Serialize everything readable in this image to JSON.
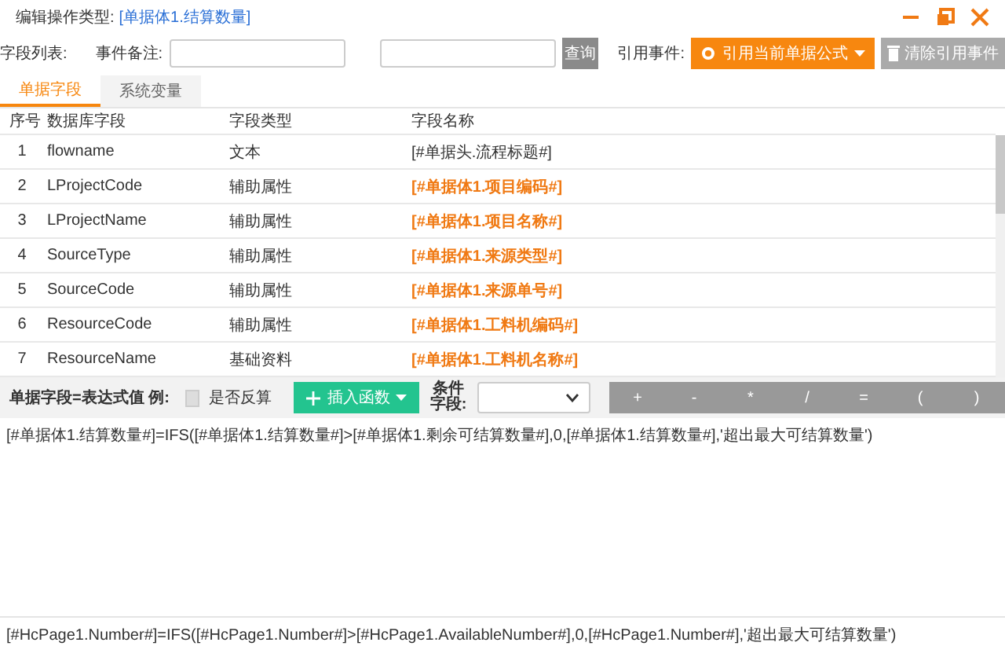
{
  "window": {
    "title_label": "编辑操作类型:",
    "title_value": "[单据体1.结算数量]"
  },
  "toolbar": {
    "field_list_label": "字段列表:",
    "remark_label": "事件备注:",
    "query_button": "查询",
    "reference_label": "引用事件:",
    "reference_button": "引用当前单据公式",
    "clear_button": "清除引用事件"
  },
  "tabs": [
    {
      "label": "单据字段",
      "selected": true
    },
    {
      "label": "系统变量",
      "selected": false
    }
  ],
  "table": {
    "columns": [
      "序号",
      "数据库字段",
      "字段类型",
      "字段名称"
    ],
    "rows": [
      {
        "no": "1",
        "field": "flowname",
        "type": "文本",
        "name": "[#单据头.流程标题#]",
        "highlighted": false
      },
      {
        "no": "2",
        "field": "LProjectCode",
        "type": "辅助属性",
        "name": "[#单据体1.项目编码#]",
        "highlighted": true
      },
      {
        "no": "3",
        "field": "LProjectName",
        "type": "辅助属性",
        "name": "[#单据体1.项目名称#]",
        "highlighted": true
      },
      {
        "no": "4",
        "field": "SourceType",
        "type": "辅助属性",
        "name": "[#单据体1.来源类型#]",
        "highlighted": true
      },
      {
        "no": "5",
        "field": "SourceCode",
        "type": "辅助属性",
        "name": "[#单据体1.来源单号#]",
        "highlighted": true
      },
      {
        "no": "6",
        "field": "ResourceCode",
        "type": "辅助属性",
        "name": "[#单据体1.工料机编码#]",
        "highlighted": true
      },
      {
        "no": "7",
        "field": "ResourceName",
        "type": "基础资料",
        "name": "[#单据体1.工料机名称#]",
        "highlighted": true
      }
    ]
  },
  "expression_bar": {
    "label": "单据字段=表达式值 例:",
    "invert_label": "是否反算",
    "invert_checked": false,
    "insert_button": "插入函数",
    "condition_label": "条件字段:",
    "operators": [
      "+",
      "-",
      "*",
      "/",
      "=",
      "(",
      ")"
    ]
  },
  "expression": "[#单据体1.结算数量#]=IFS([#单据体1.结算数量#]>[#单据体1.剩余可结算数量#],0,[#单据体1.结算数量#],'超出最大可结算数量')",
  "translated_expression": "[#HcPage1.Number#]=IFS([#HcPage1.Number#]>[#HcPage1.AvailableNumber#],0,[#HcPage1.Number#],'超出最大可结算数量')"
}
